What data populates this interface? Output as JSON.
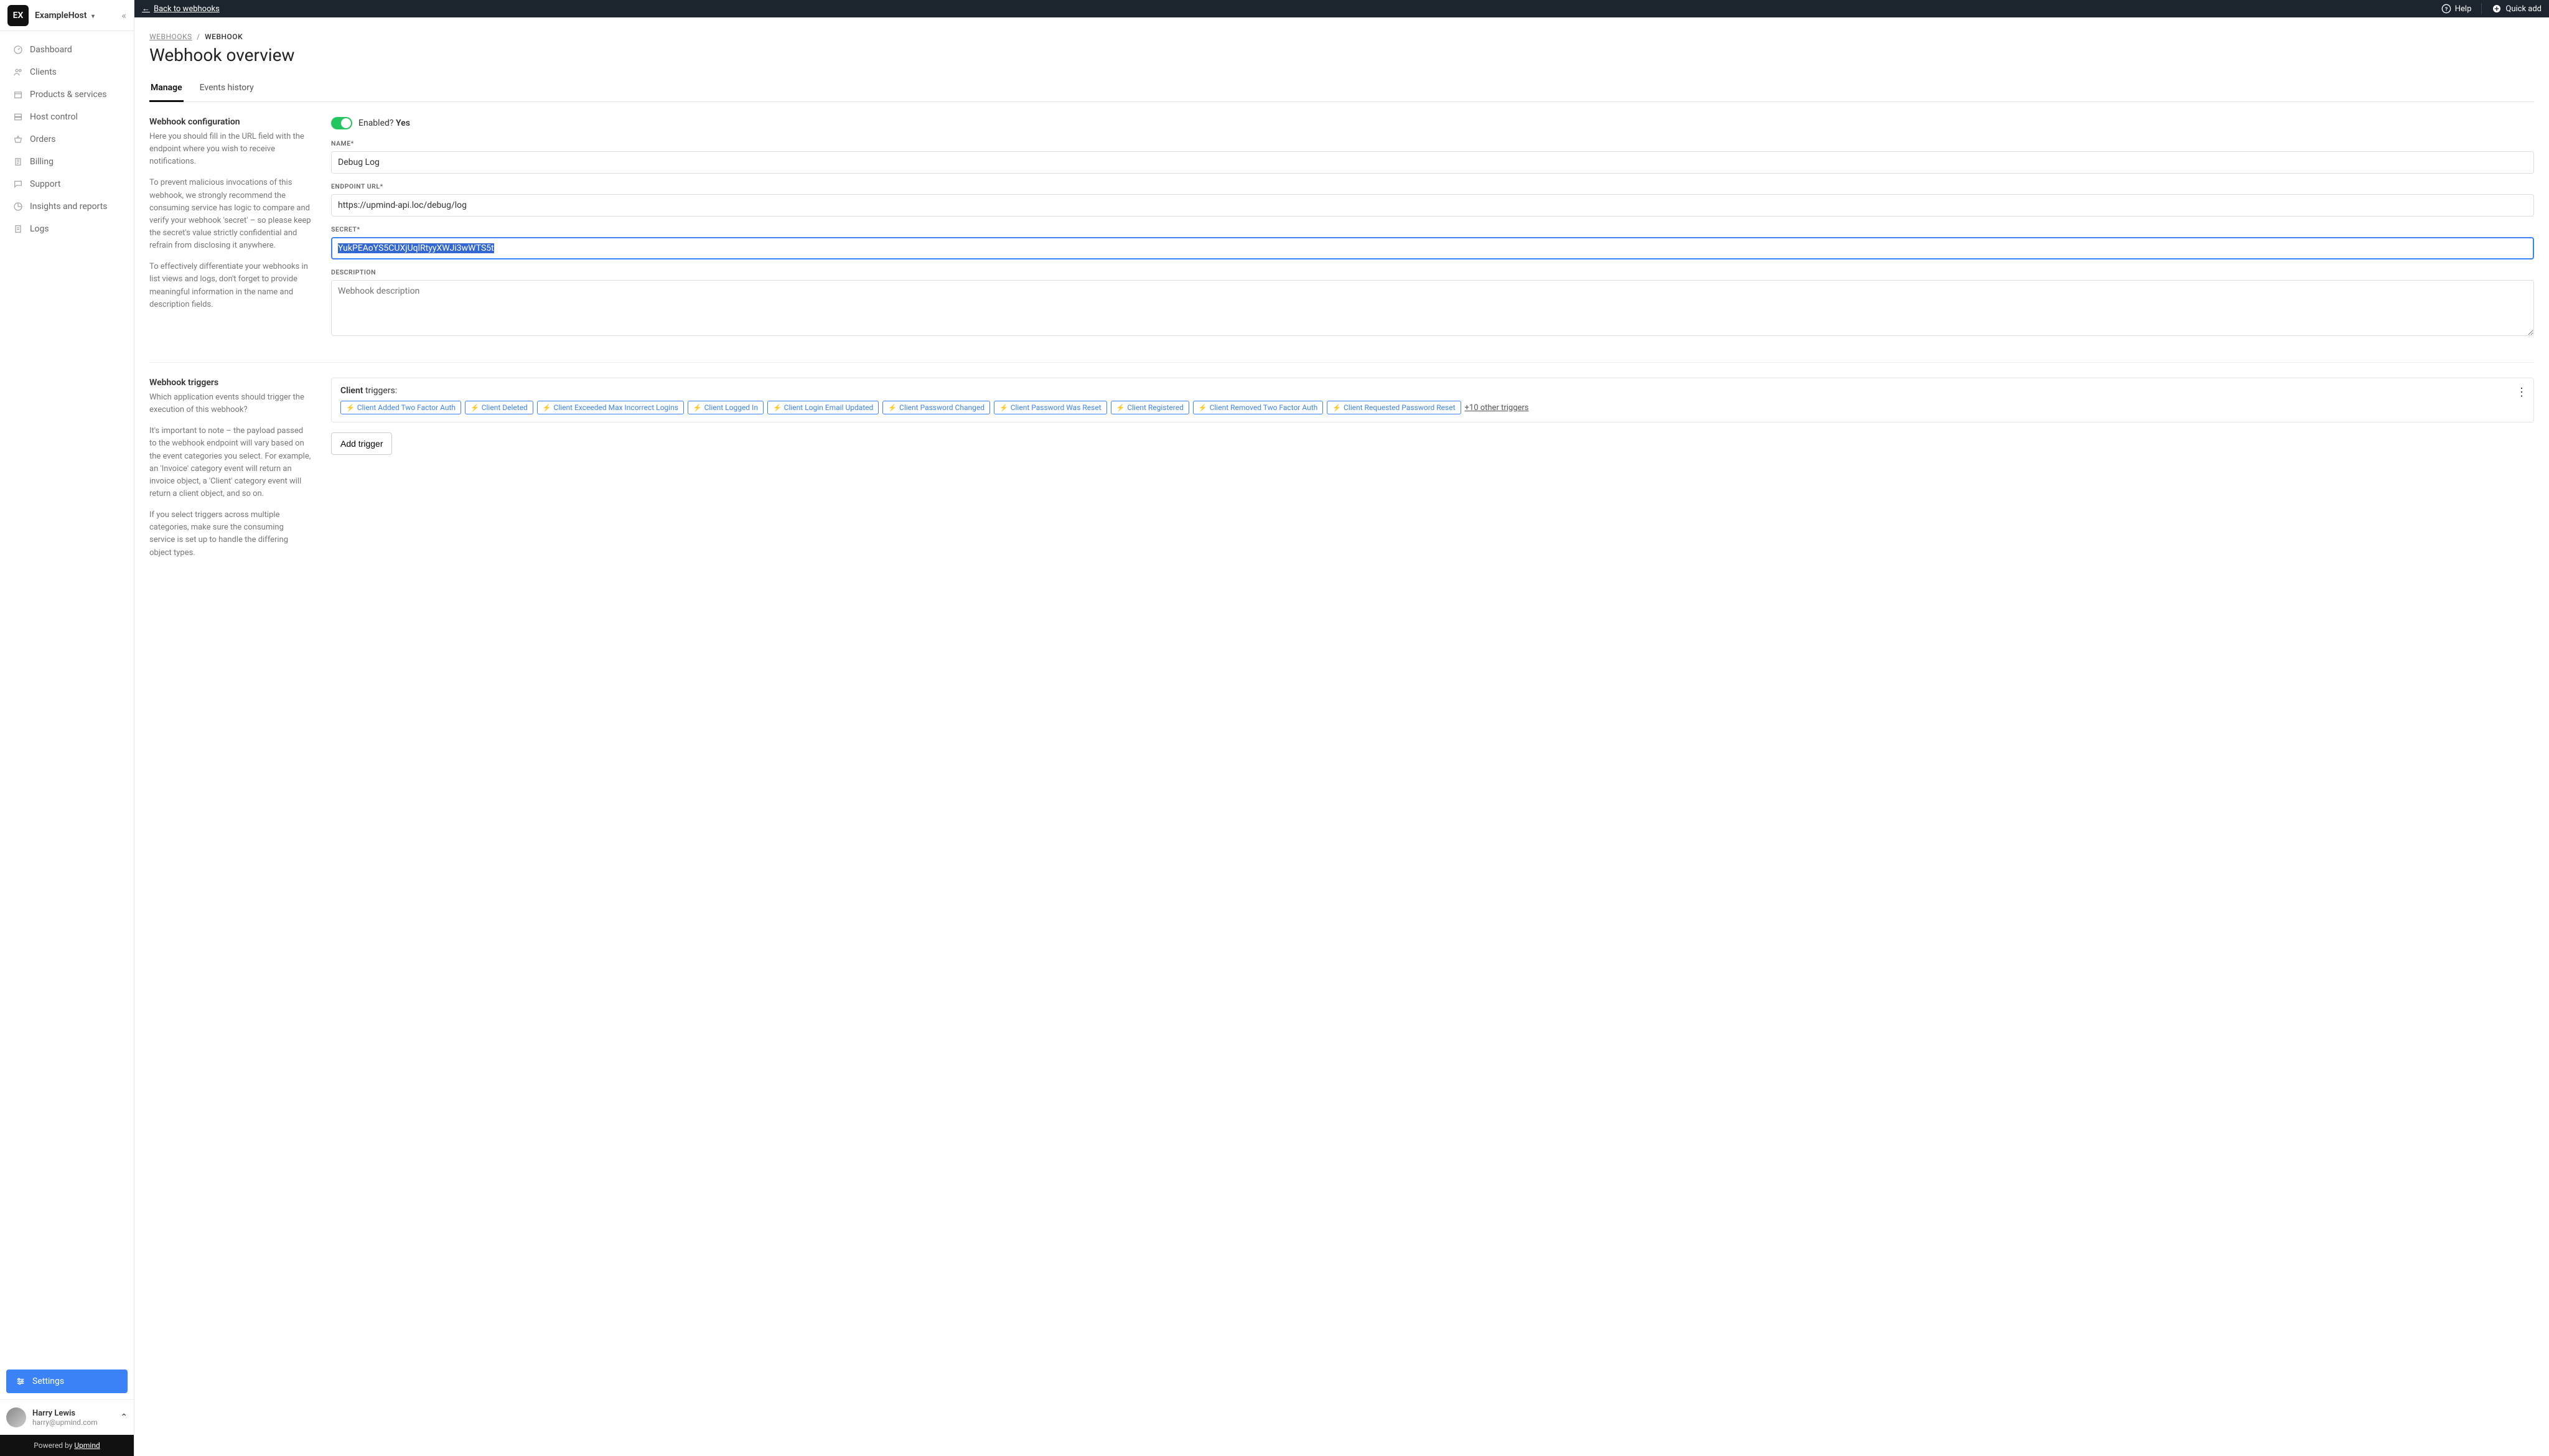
{
  "brand": {
    "logo_text": "EX",
    "name": "ExampleHost"
  },
  "sidebar": {
    "items": [
      {
        "label": "Dashboard"
      },
      {
        "label": "Clients"
      },
      {
        "label": "Products & services"
      },
      {
        "label": "Host control"
      },
      {
        "label": "Orders"
      },
      {
        "label": "Billing"
      },
      {
        "label": "Support"
      },
      {
        "label": "Insights and reports"
      },
      {
        "label": "Logs"
      }
    ],
    "settings_label": "Settings"
  },
  "user": {
    "name": "Harry Lewis",
    "email": "harry@upmind.com"
  },
  "powered": {
    "prefix": "Powered by ",
    "brand": "Upmind"
  },
  "topbar": {
    "back_label": "Back to webhooks",
    "help_label": "Help",
    "quick_add_label": "Quick add"
  },
  "breadcrumb": {
    "parent": "WEBHOOKS",
    "current": "WEBHOOK"
  },
  "page_title": "Webhook overview",
  "tabs": {
    "manage": "Manage",
    "history": "Events history"
  },
  "config": {
    "title": "Webhook configuration",
    "p1": "Here you should fill in the URL field with the endpoint where you wish to receive notifications.",
    "p2": "To prevent malicious invocations of this webhook, we strongly recommend the consuming service has logic to compare and verify your webhook 'secret' – so please keep the secret's value strictly confidential and refrain from disclosing it anywhere.",
    "p3": "To effectively differentiate your webhooks in list views and logs, don't forget to provide meaningful information in the name and description fields.",
    "enabled_label": "Enabled?",
    "enabled_value": "Yes",
    "fields": {
      "name_label": "Name*",
      "name_value": "Debug Log",
      "endpoint_label": "Endpoint URL*",
      "endpoint_value": "https://upmind-api.loc/debug/log",
      "secret_label": "Secret*",
      "secret_value": "YukPEAoYS5CUXjUqlRtyyXWJi3wWTS5t",
      "description_label": "Description",
      "description_placeholder": "Webhook description"
    }
  },
  "triggers": {
    "title": "Webhook triggers",
    "p1": "Which application events should trigger the execution of this webhook?",
    "p2": "It's important to note – the payload passed to the webhook endpoint will vary based on the event categories you select. For example, an 'Invoice' category event will return an invoice object, a 'Client' category event will return a client object, and so on.",
    "p3": "If you select triggers across multiple categories, make sure the consuming service is set up to handle the differing object types.",
    "group_label": "Client",
    "group_suffix": " triggers:",
    "chips": [
      "Client Added Two Factor Auth",
      "Client Deleted",
      "Client Exceeded Max Incorrect Logins",
      "Client Logged In",
      "Client Login Email Updated",
      "Client Password Changed",
      "Client Password Was Reset",
      "Client Registered",
      "Client Removed Two Factor Auth",
      "Client Requested Password Reset"
    ],
    "more": "+10 other triggers",
    "add_button": "Add trigger"
  }
}
